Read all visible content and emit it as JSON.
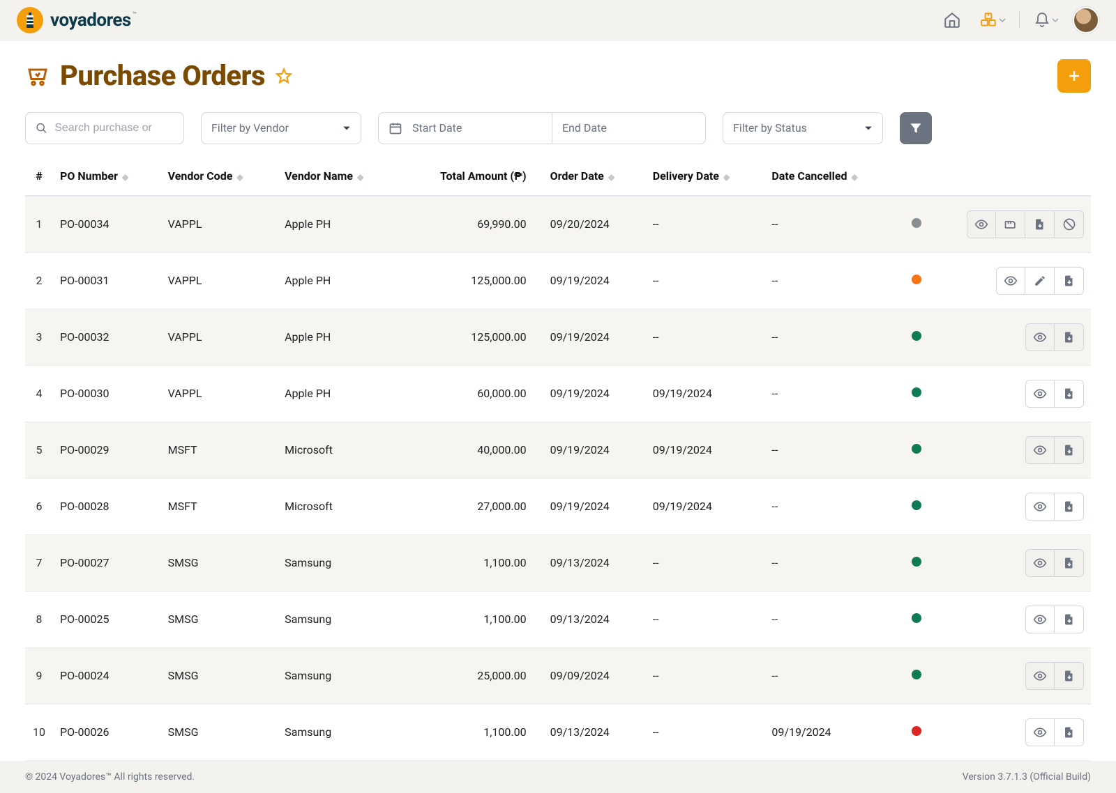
{
  "brand": {
    "name": "voyadores",
    "tm": "™"
  },
  "topbar": {
    "home_icon": "home-icon",
    "package_icon": "package-icon",
    "bell_icon": "bell-icon"
  },
  "page": {
    "title": "Purchase Orders"
  },
  "filters": {
    "search_placeholder": "Search purchase or",
    "vendor_placeholder": "Filter by Vendor",
    "start_date_placeholder": "Start Date",
    "end_date_placeholder": "End Date",
    "status_placeholder": "Filter by Status"
  },
  "table": {
    "columns": {
      "idx": "#",
      "po_number": "PO Number",
      "vendor_code": "Vendor Code",
      "vendor_name": "Vendor Name",
      "total_amount": "Total Amount (₱)",
      "order_date": "Order Date",
      "delivery_date": "Delivery Date",
      "date_cancelled": "Date Cancelled"
    },
    "rows": [
      {
        "idx": "1",
        "po_number": "PO-00034",
        "vendor_code": "VAPPL",
        "vendor_name": "Apple PH",
        "total_amount": "69,990.00",
        "order_date": "09/20/2024",
        "delivery_date": "--",
        "date_cancelled": "--",
        "status": "gray",
        "actions": [
          "view",
          "receive",
          "file",
          "cancel"
        ]
      },
      {
        "idx": "2",
        "po_number": "PO-00031",
        "vendor_code": "VAPPL",
        "vendor_name": "Apple PH",
        "total_amount": "125,000.00",
        "order_date": "09/19/2024",
        "delivery_date": "--",
        "date_cancelled": "--",
        "status": "orange",
        "actions": [
          "view",
          "edit",
          "file"
        ]
      },
      {
        "idx": "3",
        "po_number": "PO-00032",
        "vendor_code": "VAPPL",
        "vendor_name": "Apple PH",
        "total_amount": "125,000.00",
        "order_date": "09/19/2024",
        "delivery_date": "--",
        "date_cancelled": "--",
        "status": "green",
        "actions": [
          "view",
          "file"
        ]
      },
      {
        "idx": "4",
        "po_number": "PO-00030",
        "vendor_code": "VAPPL",
        "vendor_name": "Apple PH",
        "total_amount": "60,000.00",
        "order_date": "09/19/2024",
        "delivery_date": "09/19/2024",
        "date_cancelled": "--",
        "status": "green",
        "actions": [
          "view",
          "file"
        ]
      },
      {
        "idx": "5",
        "po_number": "PO-00029",
        "vendor_code": "MSFT",
        "vendor_name": "Microsoft",
        "total_amount": "40,000.00",
        "order_date": "09/19/2024",
        "delivery_date": "09/19/2024",
        "date_cancelled": "--",
        "status": "green",
        "actions": [
          "view",
          "file"
        ]
      },
      {
        "idx": "6",
        "po_number": "PO-00028",
        "vendor_code": "MSFT",
        "vendor_name": "Microsoft",
        "total_amount": "27,000.00",
        "order_date": "09/19/2024",
        "delivery_date": "09/19/2024",
        "date_cancelled": "--",
        "status": "green",
        "actions": [
          "view",
          "file"
        ]
      },
      {
        "idx": "7",
        "po_number": "PO-00027",
        "vendor_code": "SMSG",
        "vendor_name": "Samsung",
        "total_amount": "1,100.00",
        "order_date": "09/13/2024",
        "delivery_date": "--",
        "date_cancelled": "--",
        "status": "green",
        "actions": [
          "view",
          "file"
        ]
      },
      {
        "idx": "8",
        "po_number": "PO-00025",
        "vendor_code": "SMSG",
        "vendor_name": "Samsung",
        "total_amount": "1,100.00",
        "order_date": "09/13/2024",
        "delivery_date": "--",
        "date_cancelled": "--",
        "status": "green",
        "actions": [
          "view",
          "file"
        ]
      },
      {
        "idx": "9",
        "po_number": "PO-00024",
        "vendor_code": "SMSG",
        "vendor_name": "Samsung",
        "total_amount": "25,000.00",
        "order_date": "09/09/2024",
        "delivery_date": "--",
        "date_cancelled": "--",
        "status": "green",
        "actions": [
          "view",
          "file"
        ]
      },
      {
        "idx": "10",
        "po_number": "PO-00026",
        "vendor_code": "SMSG",
        "vendor_name": "Samsung",
        "total_amount": "1,100.00",
        "order_date": "09/13/2024",
        "delivery_date": "--",
        "date_cancelled": "09/19/2024",
        "status": "red",
        "actions": [
          "view",
          "file"
        ]
      }
    ]
  },
  "footer": {
    "copyright": "© 2024 Voyadores™ All rights reserved.",
    "version": "Version 3.7.1.3 (Official Build)"
  }
}
